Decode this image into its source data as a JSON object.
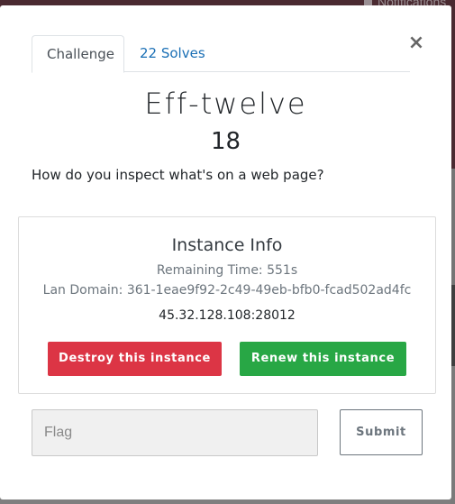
{
  "background": {
    "notification_text": "Notifications"
  },
  "modal": {
    "tabs": [
      {
        "label": "Challenge",
        "active": true
      },
      {
        "label": "22 Solves",
        "active": false
      }
    ],
    "close_symbol": "×",
    "challenge": {
      "name": "Eff-twelve",
      "value": "18",
      "description": "How do you inspect what's on a web page?"
    },
    "instance": {
      "title": "Instance Info",
      "remaining_time": "Remaining Time: 551s",
      "lan_domain": "Lan Domain: 361-1eae9f92-2c49-49eb-bfb0-fcad502ad4fc",
      "address": "45.32.128.108:28012",
      "destroy_label": "Destroy this instance",
      "renew_label": "Renew this instance"
    },
    "flag_form": {
      "placeholder": "Flag",
      "value": "",
      "submit_label": "Submit"
    }
  },
  "colors": {
    "danger": "#dc3545",
    "success": "#28a745",
    "link": "#1a6fb5",
    "header_bg": "#4a2a31"
  }
}
